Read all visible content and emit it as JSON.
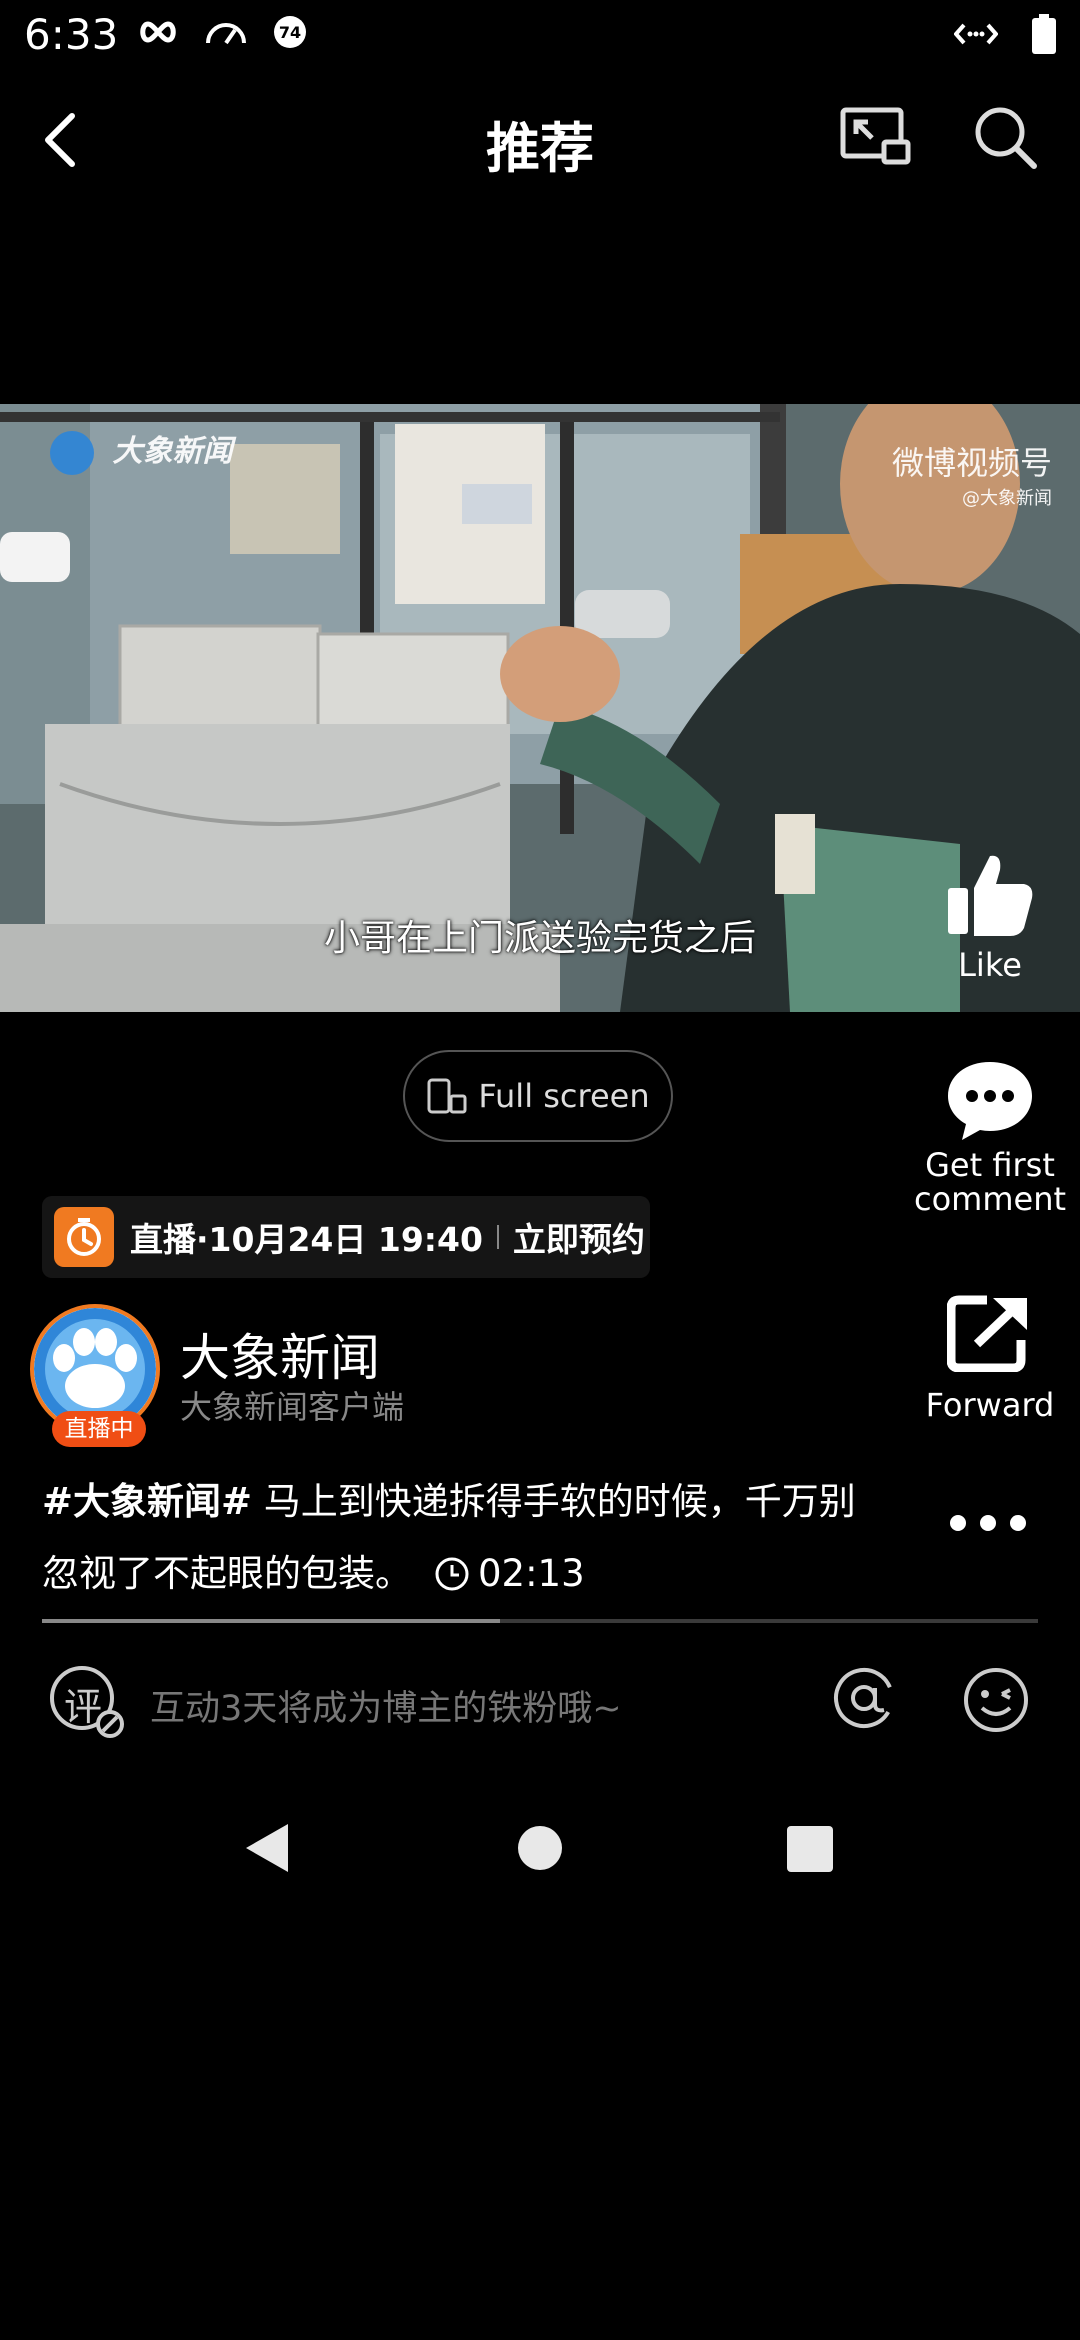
{
  "status_bar": {
    "time": "6:33",
    "nfc_badge": "74"
  },
  "header": {
    "title": "推荐"
  },
  "video": {
    "subtitle": "小哥在上门派送验完货之后",
    "watermark_left": "大象新闻",
    "watermark_right": "微博视频号",
    "watermark_right_sub": "@大象新闻"
  },
  "actions": {
    "like_label": "Like",
    "comment_label": "Get first comment",
    "forward_label": "Forward"
  },
  "fullscreen_label": "Full screen",
  "live": {
    "text": "直播·10月24日 19:40",
    "action": "立即预约"
  },
  "account": {
    "name": "大象新闻",
    "subtitle": "大象新闻客户端",
    "live_badge": "直播中"
  },
  "caption": {
    "tag": "#大象新闻#",
    "text": " 马上到快递拆得手软的时候，千万别忽视了不起眼的包装。",
    "duration": "02:13"
  },
  "progress": {
    "fraction": 0.46
  },
  "comment": {
    "placeholder": "互动3天将成为博主的铁粉哦~",
    "comment_icon_char": "评"
  },
  "icons": [
    "back-icon",
    "pip-icon",
    "search-icon",
    "like-icon",
    "comment-icon",
    "forward-icon",
    "more-icon",
    "clock-icon",
    "at-icon",
    "emoji-icon"
  ]
}
